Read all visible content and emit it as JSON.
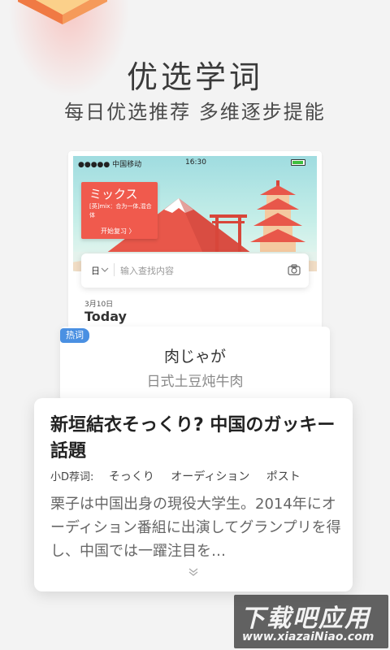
{
  "headline": "优选学词",
  "subline": "每日优选推荐  多维逐步提能",
  "phone": {
    "status": {
      "carrier": "●●●●● 中国移动",
      "time": "16:30"
    },
    "word_card": {
      "kana": "ミックス",
      "definition": "[英]mix：合为一体,混合体",
      "review_label": "开始复习 〉"
    },
    "search": {
      "lang": "日",
      "placeholder": "输入查找内容"
    },
    "date": "3月10日",
    "today": "Today"
  },
  "hot": {
    "badge": "热词",
    "word": "肉じゃが",
    "meaning": "日式土豆炖牛肉"
  },
  "article": {
    "title": "新垣結衣そっくり? 中国のガッキー話題",
    "tag_label": "小D荐词:",
    "tags": [
      "そっくり",
      "オーディション",
      "ポスト"
    ],
    "body": "栗子は中国出身の現役大学生。2014年にオーディション番組に出演してグランプリを得し、中国では一躍注目を…"
  },
  "watermark": {
    "brand": "下载吧应用",
    "url": "www.xiazaiNiao.com"
  },
  "colors": {
    "accent_red": "#f05a4d",
    "badge_blue": "#4a90e2"
  }
}
